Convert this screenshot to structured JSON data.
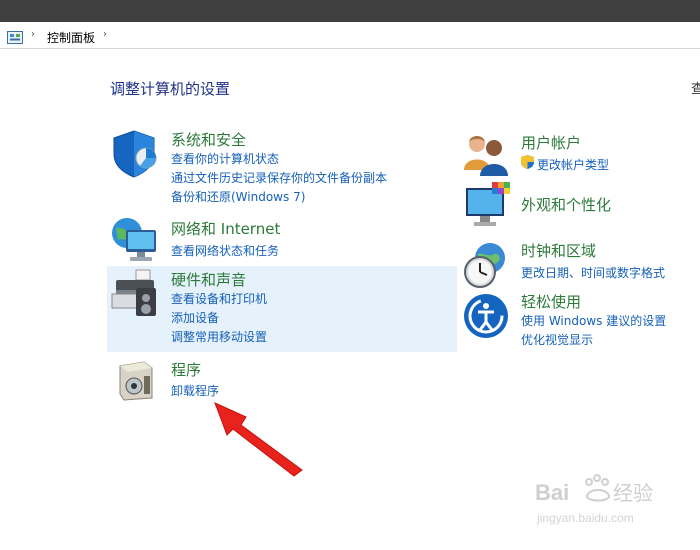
{
  "address": {
    "path": "控制面板"
  },
  "main": {
    "heading": "调整计算机的设置",
    "viewby": "查"
  },
  "categories": {
    "system": {
      "title": "系统和安全",
      "links": [
        "查看你的计算机状态",
        "通过文件历史记录保存你的文件备份副本",
        "备份和还原(Windows 7)"
      ]
    },
    "network": {
      "title": "网络和 Internet",
      "links": [
        "查看网络状态和任务"
      ]
    },
    "hardware": {
      "title": "硬件和声音",
      "links": [
        "查看设备和打印机",
        "添加设备",
        "调整常用移动设置"
      ]
    },
    "programs": {
      "title": "程序",
      "links": [
        "卸载程序"
      ]
    },
    "users": {
      "title": "用户帐户",
      "links": [
        "更改帐户类型"
      ]
    },
    "appearance": {
      "title": "外观和个性化",
      "links": []
    },
    "clock": {
      "title": "时钟和区域",
      "links": [
        "更改日期、时间或数字格式"
      ]
    },
    "ease": {
      "title": "轻松使用",
      "links": [
        "使用 Windows 建议的设置",
        "优化视觉显示"
      ]
    }
  },
  "watermark": {
    "text": "Bai度 经验",
    "subtext": "jingyan.baidu.com"
  },
  "colors": {
    "title_green": "#2c7a3a",
    "link_blue": "#1660b8",
    "heading_blue": "#1e3287",
    "highlight": "#e5f1fb",
    "arrow_red": "#e8231d"
  }
}
